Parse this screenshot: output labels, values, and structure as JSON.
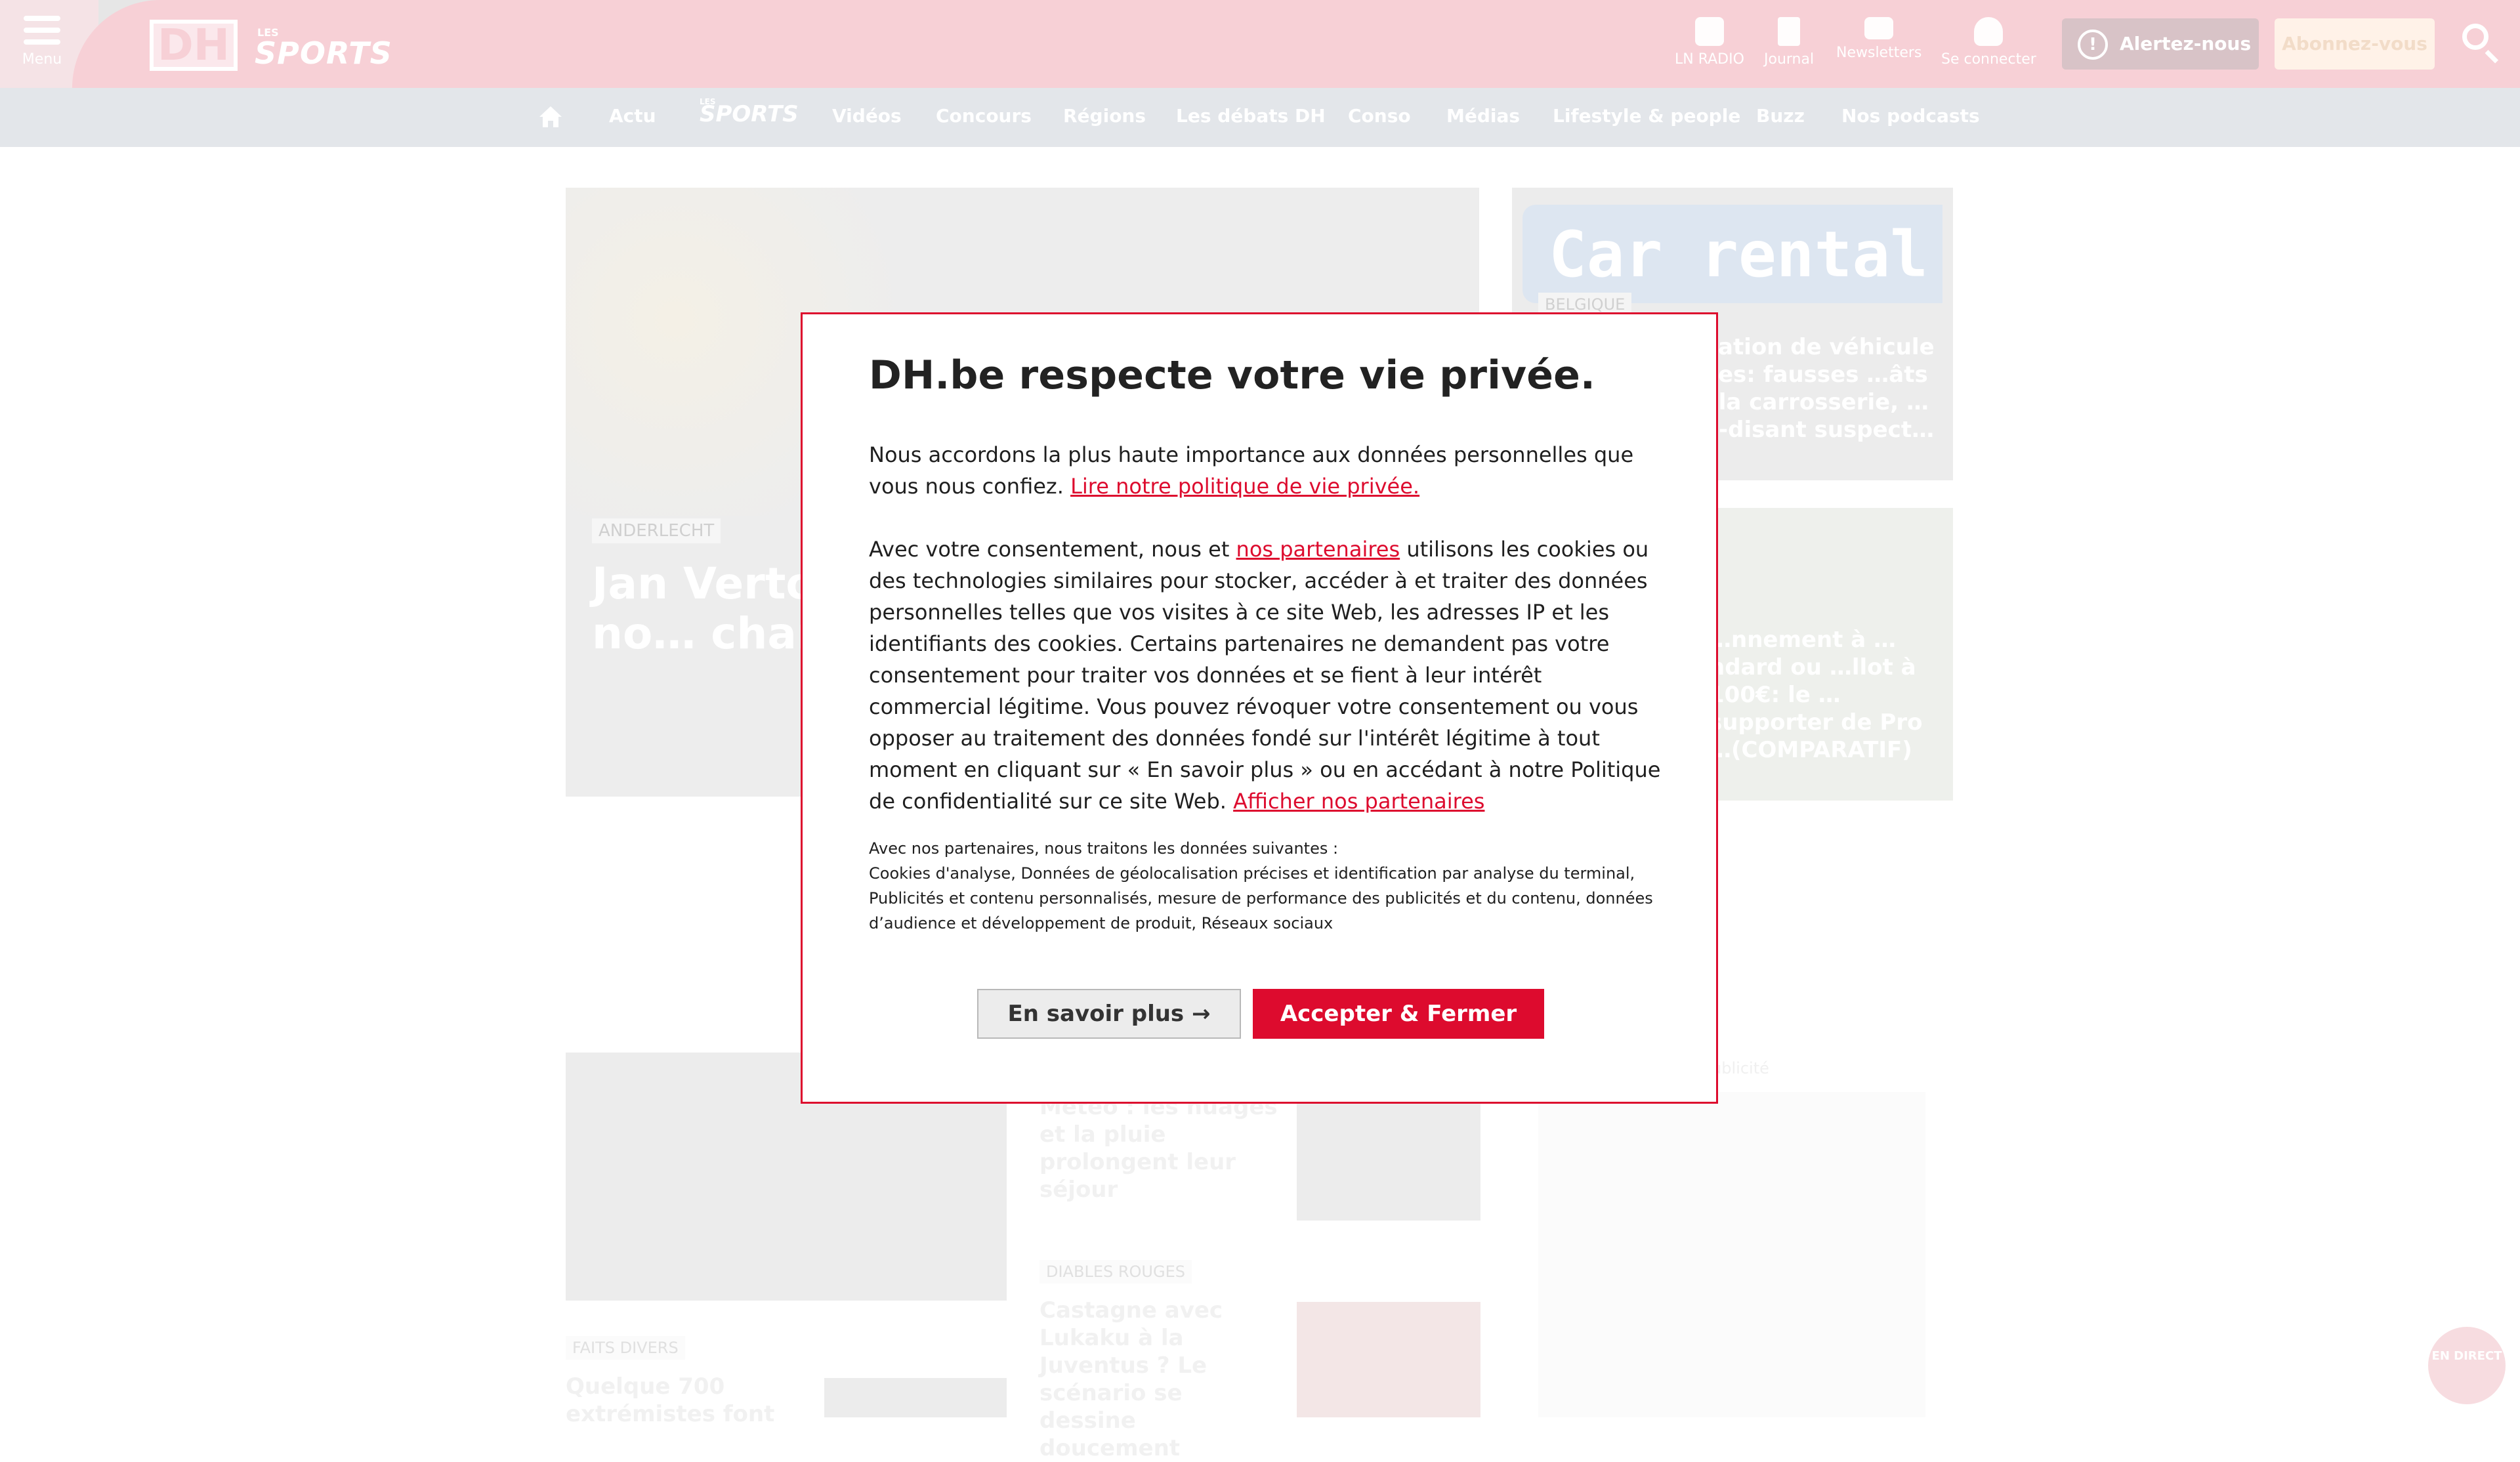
{
  "header": {
    "menu_label": "Menu",
    "logo_dh": "DH",
    "logo_les": "LES",
    "logo_sports": "SPORTS",
    "icons": [
      {
        "name": "radio-icon",
        "label": "LN RADIO"
      },
      {
        "name": "journal-icon",
        "label": "Journal"
      },
      {
        "name": "newsletter-icon",
        "label": "Newsletters"
      },
      {
        "name": "user-icon",
        "label": "Se connecter"
      }
    ],
    "alert_button": "Alertez-nous",
    "subscribe_button": "Abonnez-vous"
  },
  "nav": {
    "items": [
      "Actu",
      "Vidéos",
      "Concours",
      "Régions",
      "Les débats DH",
      "Conso",
      "Médias",
      "Lifestyle & people",
      "Buzz",
      "Nos podcasts"
    ],
    "sports_les": "LES",
    "sports": "SPORTS"
  },
  "content": {
    "hero_tag": "ANDERLECHT",
    "hero_title": "Jan Verton… d'Anderlec… place, il no… champion…",
    "card1_sign": "Car rental",
    "card1_tag": "BELGIQUE",
    "card1_title": "…ation de véhicule …es: fausses …âts à la carrosserie, …oi-disant suspect…",
    "card2_title": "…nnement à …ndard ou …llot à 100€: le …supporter de Pro …(COMPARATIF)",
    "meteo_title": "Météo : les nuages et la pluie prolongent leur séjour",
    "diables_tag": "DIABLES ROUGES",
    "diables_title": "Castagne avec Lukaku à la Juventus ? Le scénario se dessine doucement",
    "faits_tag": "FAITS DIVERS",
    "faits_title": "Quelque 700 extrémistes font",
    "pub_label": "Publicité",
    "live_label": "EN DIRECT"
  },
  "modal": {
    "title": "DH.be respecte votre vie privée.",
    "p1_text": "Nous accordons la plus haute importance aux données personnelles que vous nous confiez. ",
    "p1_link": "Lire notre politique de vie privée.",
    "p2_pre": "Avec votre consentement, nous et ",
    "p2_link": "nos partenaires",
    "p2_post": " utilisons les cookies ou des technologies similaires pour stocker, accéder à et traiter des données personnelles telles que vos visites à ce site Web, les adresses IP et les identifiants des cookies. Certains partenaires ne demandent pas votre consentement pour traiter vos données et se fient à leur intérêt commercial légitime. Vous pouvez révoquer votre consentement ou vous opposer au traitement des données fondé sur l'intérêt légitime à tout moment en cliquant sur « En savoir plus » ou en accédant à notre Politique de confidentialité sur ce site Web. ",
    "p2_link2": "Afficher nos partenaires",
    "small_heading": "Avec nos partenaires, nous traitons les données suivantes :",
    "small_body": "Cookies d'analyse, Données de géolocalisation précises et identification par analyse du terminal, Publicités et contenu personnalisés, mesure de performance des publicités et du contenu, données d’audience et développement de produit, Réseaux sociaux",
    "learn_more": "En savoir plus →",
    "accept": "Accepter & Fermer"
  },
  "colors": {
    "brand_red": "#dd0b2e",
    "header_pink": "#f7d0d6"
  }
}
